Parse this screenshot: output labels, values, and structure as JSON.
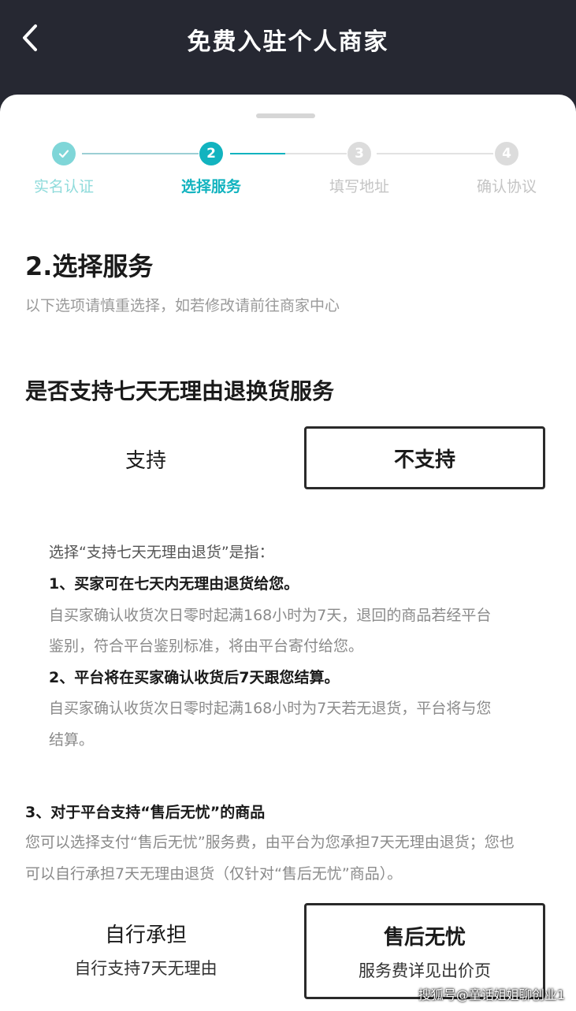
{
  "header": {
    "title": "免费入驻个人商家",
    "back_icon": "chevron-left-icon"
  },
  "stepper": {
    "steps": [
      {
        "label": "实名认证",
        "number": "",
        "state": "done"
      },
      {
        "label": "选择服务",
        "number": "2",
        "state": "current"
      },
      {
        "label": "填写地址",
        "number": "3",
        "state": "todo"
      },
      {
        "label": "确认协议",
        "number": "4",
        "state": "todo"
      }
    ],
    "colors": {
      "accent": "#12b3bf",
      "done": "#7fd6d8",
      "todo": "#dcdcdc",
      "line_done": "#9ccfd4"
    }
  },
  "section": {
    "title": "2.选择服务",
    "subtitle": "以下选项请慎重选择，如若修改请前往商家中心"
  },
  "question": {
    "title": "是否支持七天无理由退换货服务",
    "options": [
      {
        "label": "支持",
        "selected": false
      },
      {
        "label": "不支持",
        "selected": true
      }
    ]
  },
  "info": {
    "heading": "选择“支持七天无理由退货”是指：",
    "item1_title": "1、买家可在七天内无理由退货给您。",
    "item1_desc_line1": "自买家确认收货次日零时起满168小时为7天，退回的商品若经平台",
    "item1_desc_line2": "鉴别，符合平台鉴别标准，将由平台寄付给您。",
    "item2_title": "2、平台将在买家确认收货后7天跟您结算。",
    "item2_desc_line1": "自买家确认收货次日零时起满168小时为7天若无退货，平台将与您",
    "item2_desc_line2": "结算。"
  },
  "note3": {
    "title": "3、对于平台支持“售后无忧”的商品",
    "line1": "您可以选择支付“售后无忧”服务费，由平台为您承担7天无理由退货；您也",
    "line2": "可以自行承担7天无理由退货（仅针对“售后无忧”商品）。"
  },
  "aftersale": {
    "options": [
      {
        "label": "自行承担",
        "sub": "自行支持7天无理由",
        "selected": false
      },
      {
        "label": "售后无忧",
        "sub": "服务费详见出价页",
        "selected": true
      }
    ]
  },
  "watermark": "搜狐号@童话姐姐聊创业1"
}
